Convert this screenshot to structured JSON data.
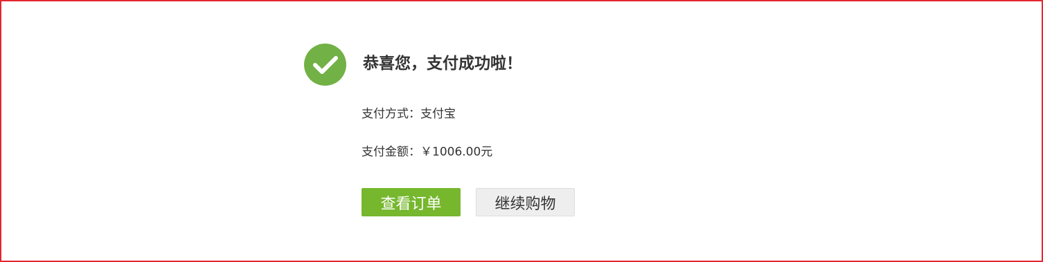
{
  "message": {
    "title": "恭喜您，支付成功啦！"
  },
  "payment": {
    "method_label": "支付方式：",
    "method_value": "支付宝",
    "amount_label": "支付金额：",
    "amount_value": "￥1006.00元"
  },
  "actions": {
    "view_order_label": "查看订单",
    "continue_shopping_label": "继续购物"
  },
  "icons": {
    "success": "check-circle-icon"
  },
  "colors": {
    "success_green": "#72b145",
    "primary_button": "#76b72e",
    "secondary_button": "#eeeeee",
    "frame_border": "#e4262f",
    "text": "#333333"
  }
}
